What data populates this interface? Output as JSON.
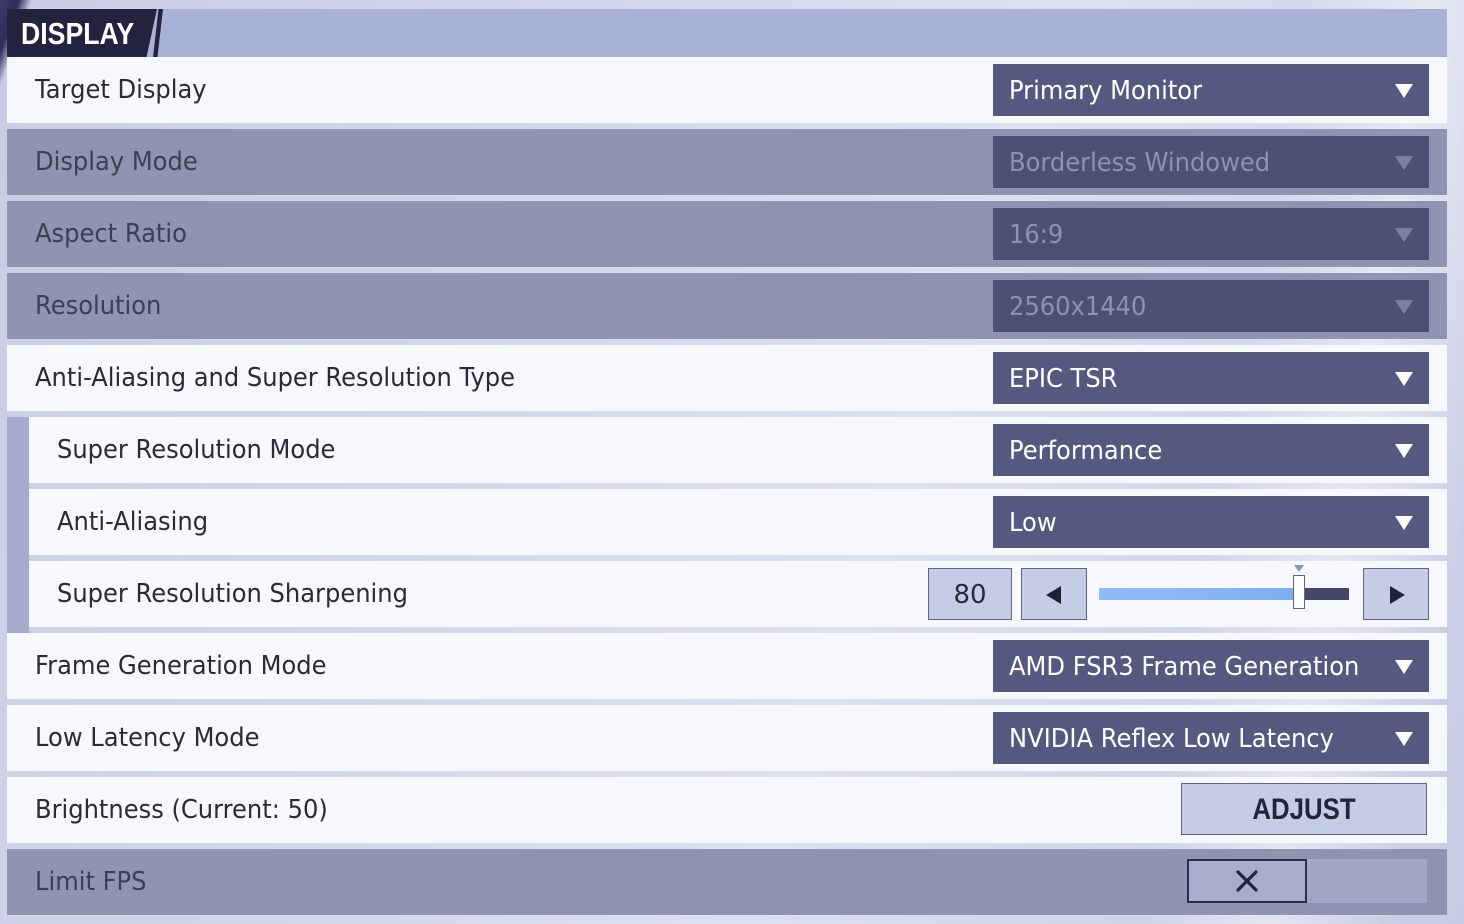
{
  "section": {
    "title": "DISPLAY"
  },
  "rows": {
    "target_display": {
      "label": "Target Display",
      "value": "Primary Monitor"
    },
    "display_mode": {
      "label": "Display Mode",
      "value": "Borderless Windowed"
    },
    "aspect_ratio": {
      "label": "Aspect Ratio",
      "value": "16:9"
    },
    "resolution": {
      "label": "Resolution",
      "value": "2560x1440"
    },
    "aa_sr_type": {
      "label": "Anti-Aliasing and Super Resolution Type",
      "value": "EPIC TSR"
    },
    "sr_mode": {
      "label": "Super Resolution Mode",
      "value": "Performance"
    },
    "anti_aliasing": {
      "label": "Anti-Aliasing",
      "value": "Low"
    },
    "sr_sharpening": {
      "label": "Super Resolution Sharpening",
      "value": "80",
      "level": 0.8
    },
    "frame_gen": {
      "label": "Frame Generation Mode",
      "value": "AMD FSR3 Frame Generation"
    },
    "low_latency": {
      "label": "Low Latency Mode",
      "value": "NVIDIA Reflex Low Latency"
    },
    "brightness": {
      "label": "Brightness (Current: 50)",
      "button": "ADJUST"
    },
    "limit_fps": {
      "label": "Limit FPS",
      "enabled": false
    }
  },
  "icons": {
    "dropdown": "chevron-down-icon",
    "decrease": "arrow-left-icon",
    "increase": "arrow-right-icon",
    "toggle_off": "x-icon"
  },
  "colors": {
    "header": "#a9b1d6",
    "header_tab": "#24233f",
    "row_active": "#f7f8fc",
    "row_disabled": "#8e94b1",
    "dropdown": "#56597f",
    "slider_fill": "#8fbdf5"
  }
}
